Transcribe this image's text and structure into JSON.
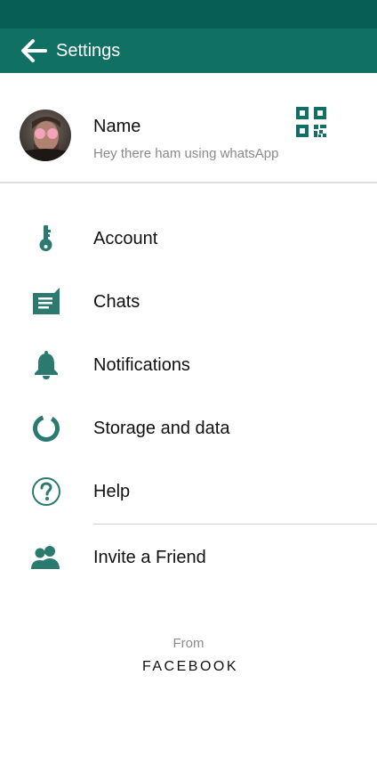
{
  "colors": {
    "status_bar": "#075e54",
    "app_bar": "#0f7063",
    "icon": "#2a7a70"
  },
  "header": {
    "title": "Settings",
    "back_icon": "arrow-left-icon"
  },
  "profile": {
    "name": "Name",
    "status": "Hey there ham using whatsApp",
    "qr_icon": "qr-code-icon"
  },
  "menu": [
    {
      "label": "Account",
      "icon": "key-icon"
    },
    {
      "label": "Chats",
      "icon": "chat-icon"
    },
    {
      "label": "Notifications",
      "icon": "bell-icon"
    },
    {
      "label": "Storage and data",
      "icon": "storage-icon"
    },
    {
      "label": "Help",
      "icon": "help-icon"
    },
    {
      "label": "Invite a Friend",
      "icon": "invite-friends-icon"
    }
  ],
  "footer": {
    "from": "From",
    "brand": "FACEBOOK"
  }
}
